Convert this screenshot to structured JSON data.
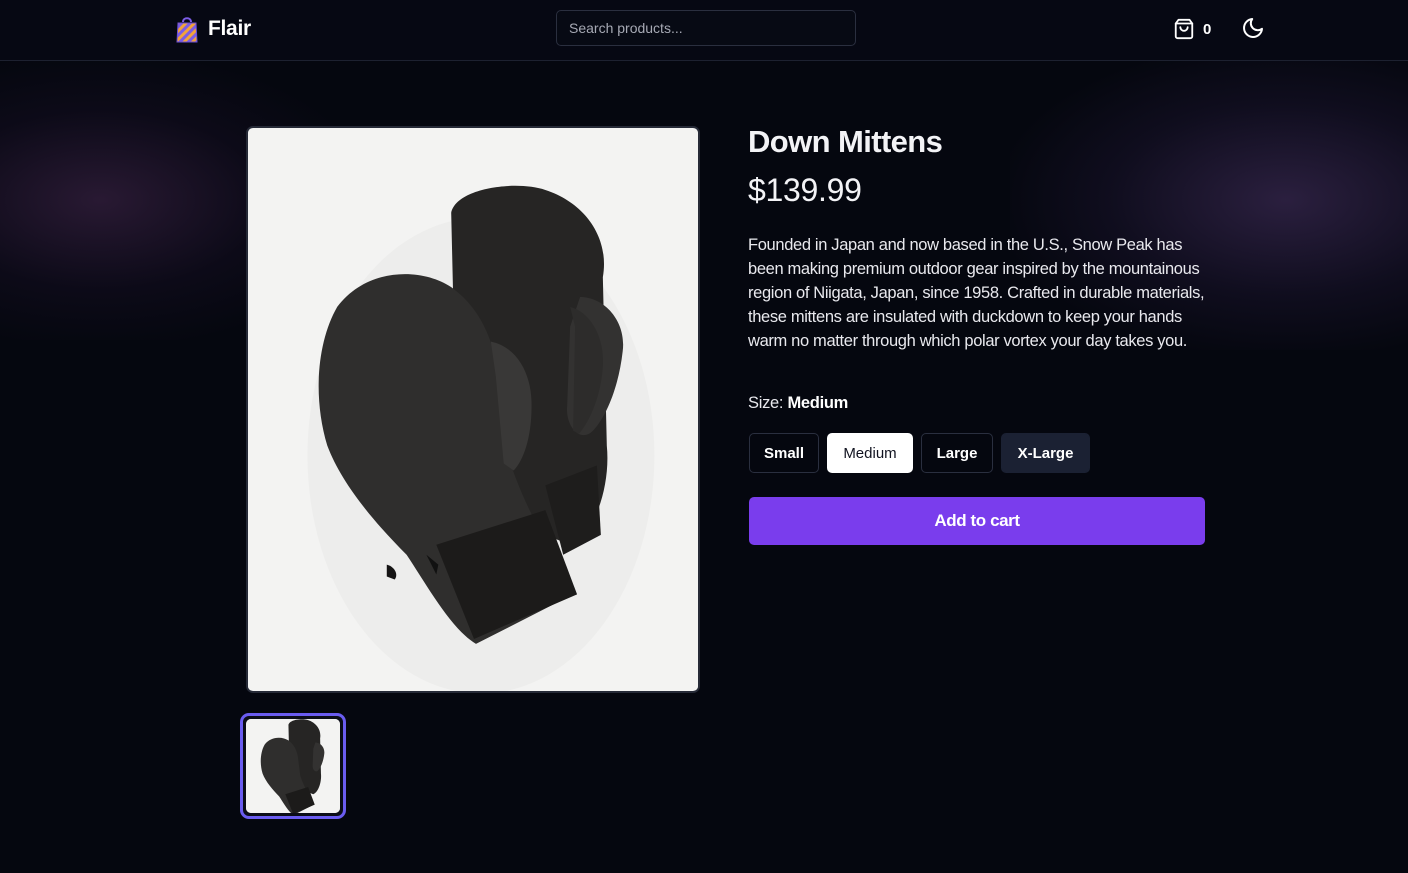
{
  "header": {
    "brand": "Flair",
    "logo_icon": "shopping-bag-icon",
    "search": {
      "placeholder": "Search products...",
      "value": ""
    },
    "cart": {
      "icon": "shopping-bag-outline-icon",
      "count": "0"
    },
    "theme_toggle_icon": "moon-icon"
  },
  "product": {
    "title": "Down Mittens",
    "price": "$139.99",
    "description": "Founded in Japan and now based in the U.S., Snow Peak has been making premium outdoor gear inspired by the mountainous region of Niigata, Japan, since 1958. Crafted in durable materials, these mittens are insulated with duckdown to keep your hands warm no matter through which polar vortex your day takes you.",
    "main_image": "black-down-mittens-photo",
    "thumbnails": [
      "black-down-mittens-photo"
    ]
  },
  "size": {
    "label": "Size:",
    "selected": "Medium",
    "options": [
      "Small",
      "Medium",
      "Large",
      "X-Large"
    ]
  },
  "actions": {
    "add_to_cart": "Add to cart"
  },
  "colors": {
    "background": "#05070f",
    "accent": "#7a3ded",
    "thumbnail_border": "#6a5cf0",
    "selected_size_bg": "#ffffff",
    "highlighted_size_bg": "#1b2133"
  }
}
